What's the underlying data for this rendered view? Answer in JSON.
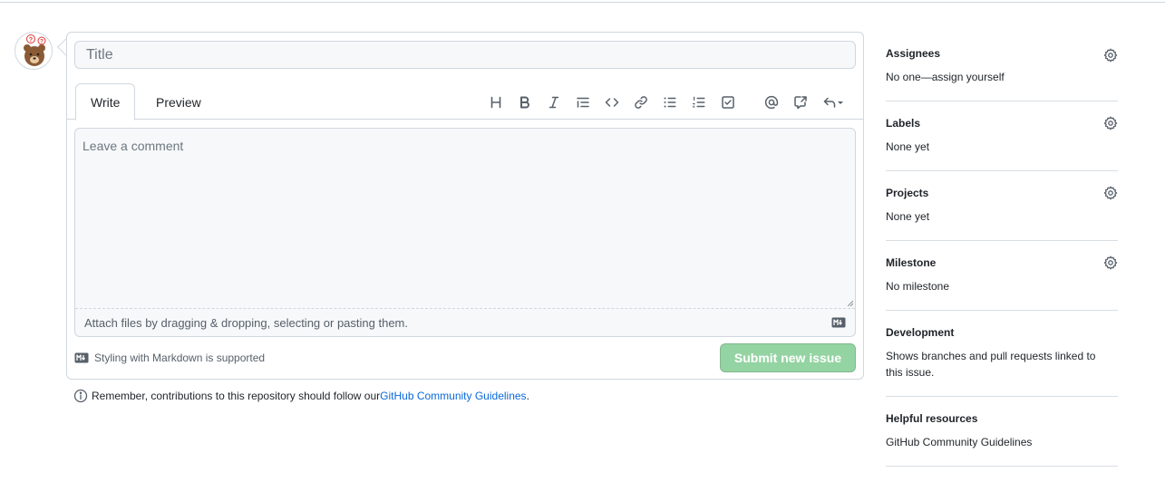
{
  "composer": {
    "title_placeholder": "Title",
    "tabs": [
      {
        "label": "Write"
      },
      {
        "label": "Preview"
      }
    ],
    "toolbar": [
      "heading-icon",
      "bold-icon",
      "italic-icon",
      "quote-icon",
      "code-icon",
      "link-icon",
      "unordered-list-icon",
      "ordered-list-icon",
      "task-list-icon",
      "mention-icon",
      "cross-reference-icon",
      "saved-replies-icon"
    ],
    "comment_placeholder": "Leave a comment",
    "attach_text": "Attach files by dragging & dropping, selecting or pasting them.",
    "markdown_note": "Styling with Markdown is supported",
    "submit_label": "Submit new issue"
  },
  "guidelines": {
    "prefix": "Remember, contributions to this repository should follow our ",
    "link": "GitHub Community Guidelines",
    "suffix": "."
  },
  "sidebar": {
    "assignees": {
      "title": "Assignees",
      "value": "No one—assign yourself"
    },
    "labels": {
      "title": "Labels",
      "value": "None yet"
    },
    "projects": {
      "title": "Projects",
      "value": "None yet"
    },
    "milestone": {
      "title": "Milestone",
      "value": "No milestone"
    },
    "development": {
      "title": "Development",
      "value": "Shows branches and pull requests linked to this issue."
    },
    "helpful": {
      "title": "Helpful resources",
      "link": "GitHub Community Guidelines"
    }
  },
  "colors": {
    "accent_link": "#0969da",
    "submit_disabled_bg": "#94d3a2",
    "border": "#d0d7de",
    "muted_text": "#57606a"
  }
}
